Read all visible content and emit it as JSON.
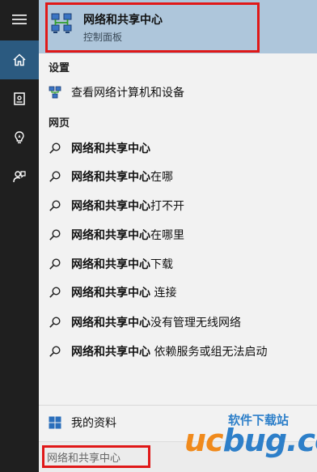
{
  "rail": {
    "items": [
      {
        "name": "menu-icon"
      },
      {
        "name": "home-icon"
      },
      {
        "name": "notebook-icon"
      },
      {
        "name": "lightbulb-icon"
      },
      {
        "name": "feedback-icon"
      }
    ],
    "active_color": "#2b5a80"
  },
  "best_match": {
    "title": "网络和共享中心",
    "subtitle": "控制面板",
    "icon": "network-sharing-icon",
    "highlight_color": "#e01818"
  },
  "settings": {
    "heading": "设置",
    "items": [
      {
        "label": "查看网络计算机和设备",
        "icon": "network-computer-icon"
      }
    ]
  },
  "web": {
    "heading": "网页",
    "items": [
      {
        "bold": "网络和共享中心",
        "rest": ""
      },
      {
        "bold": "网络和共享中心",
        "rest": "在哪"
      },
      {
        "bold": "网络和共享中心",
        "rest": "打不开"
      },
      {
        "bold": "网络和共享中心",
        "rest": "在哪里"
      },
      {
        "bold": "网络和共享中心",
        "rest": "下载"
      },
      {
        "bold": "网络和共享中心",
        "rest": " 连接"
      },
      {
        "bold": "网络和共享中心",
        "rest": "没有管理无线网络"
      },
      {
        "bold": "网络和共享中心",
        "rest": " 依赖服务或组无法启动"
      }
    ]
  },
  "bottom": {
    "profile_label": "我的资料",
    "profile_icon": "windows-logo-icon"
  },
  "search": {
    "value": "网络和共享中心"
  },
  "watermark": {
    "main": "ucbug.cc",
    "cn": "软件下载站",
    "colors": [
      "#f08a1c",
      "#2d7fc9"
    ]
  }
}
